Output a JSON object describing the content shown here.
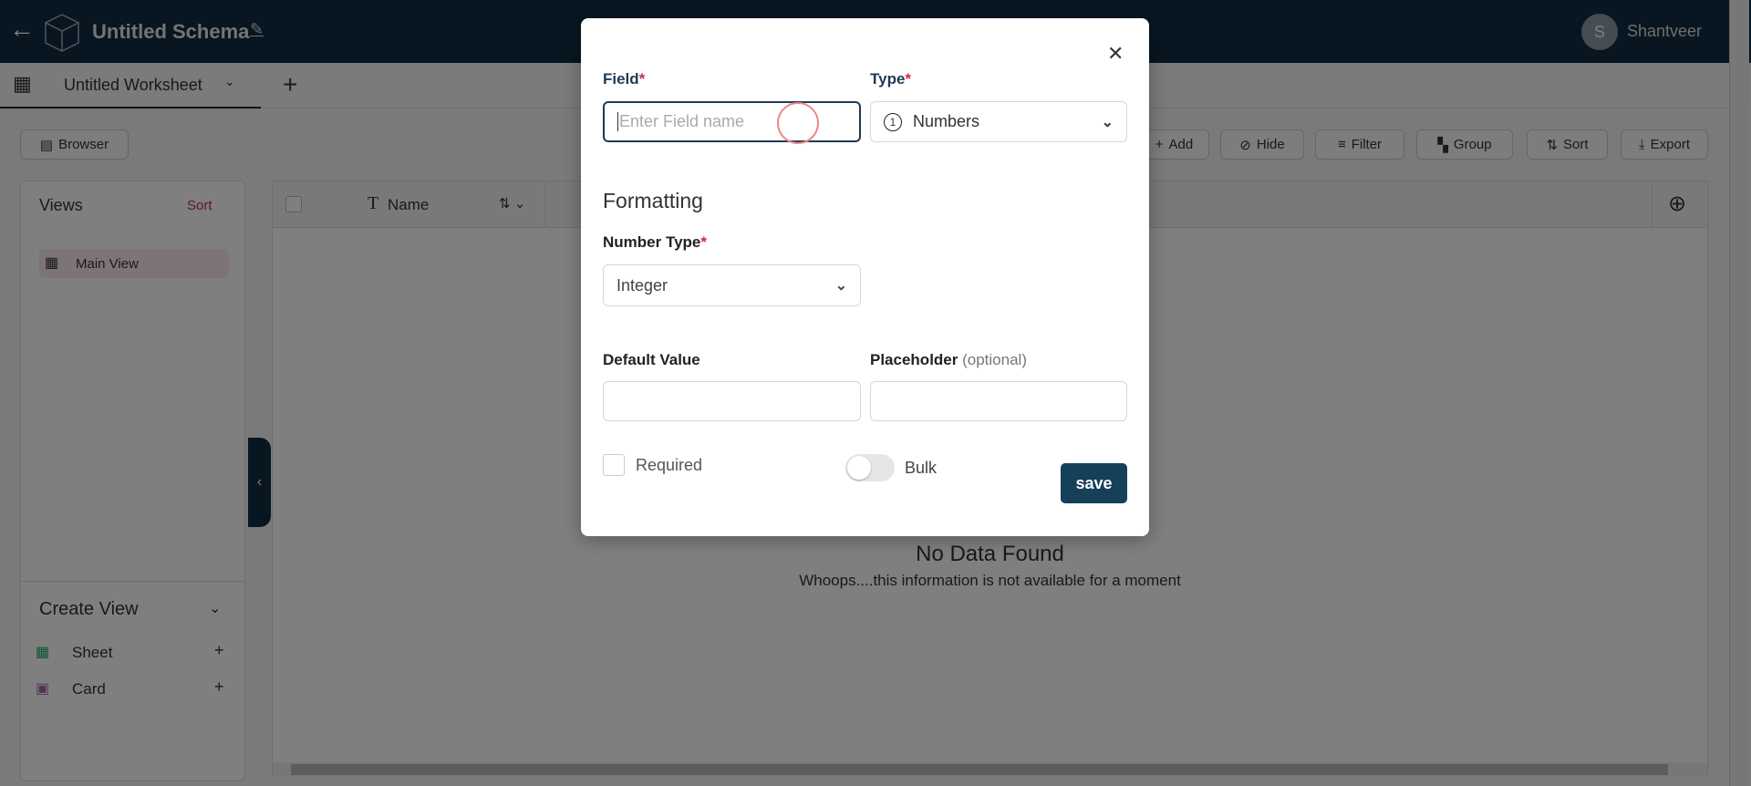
{
  "header": {
    "title": "Untitled Schema",
    "user_initial": "S",
    "user_name": "Shantveer"
  },
  "tabs": {
    "worksheet": "Untitled Worksheet"
  },
  "toolbar": {
    "browser": "Browser",
    "add": "Add",
    "hide": "Hide",
    "filter": "Filter",
    "group": "Group",
    "sort": "Sort",
    "export": "Export"
  },
  "views": {
    "title": "Views",
    "sort": "Sort",
    "items": [
      {
        "label": "Main View"
      }
    ],
    "create_title": "Create View",
    "create_items": [
      {
        "label": "Sheet"
      },
      {
        "label": "Card"
      }
    ]
  },
  "grid": {
    "column": "Name",
    "empty_title": "No Data Found",
    "empty_text": "Whoops....this information is not available for a moment"
  },
  "modal": {
    "field_label": "Field",
    "field_placeholder": "Enter Field name",
    "type_label": "Type",
    "type_value": "Numbers",
    "type_icon": "1",
    "formatting": "Formatting",
    "number_type_label": "Number Type",
    "number_type_value": "Integer",
    "default_value_label": "Default Value",
    "placeholder_label": "Placeholder",
    "placeholder_optional": "(optional)",
    "required_label": "Required",
    "bulk_label": "Bulk",
    "save": "save",
    "required_mark": "*"
  },
  "colors": {
    "brand": "#0f2c40",
    "accent": "#d0284a",
    "save": "#163f5a"
  }
}
